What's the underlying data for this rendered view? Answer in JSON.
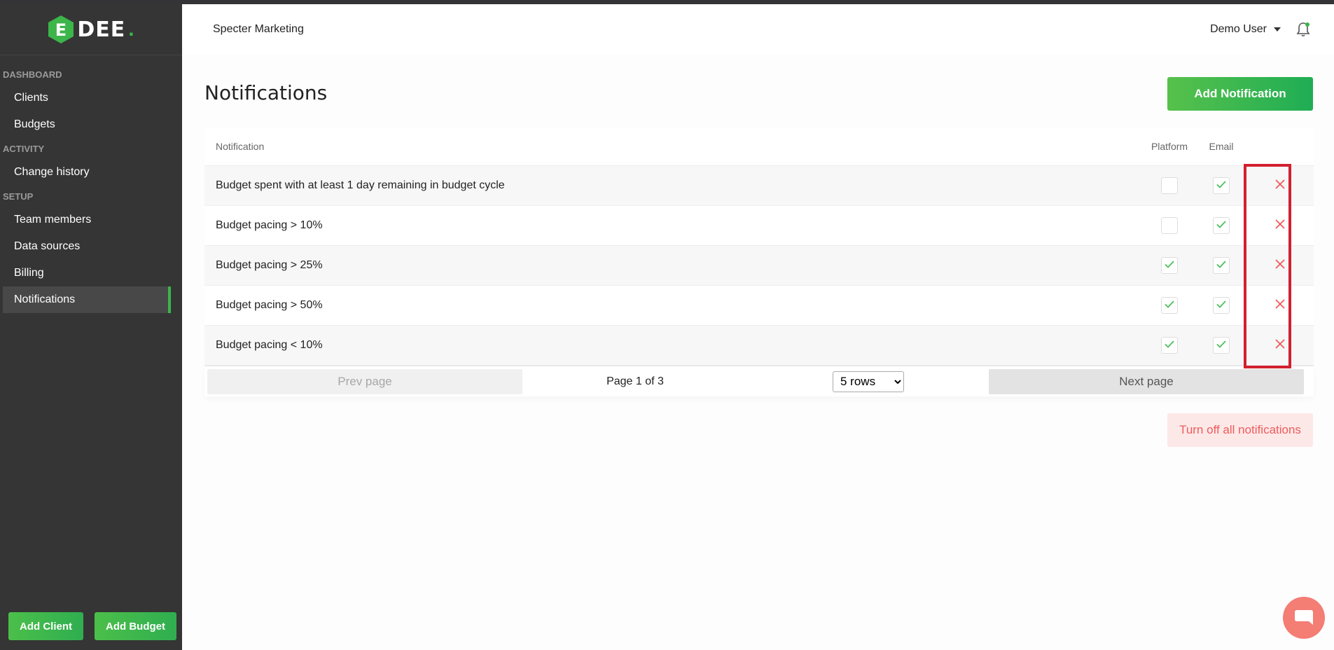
{
  "brand": {
    "logo_letter": "E",
    "logo_text": "DEE",
    "logo_dot": "."
  },
  "header": {
    "org_name": "Specter Marketing",
    "user_name": "Demo User"
  },
  "sidebar": {
    "sections": [
      {
        "title": "DASHBOARD",
        "items": [
          "Clients",
          "Budgets"
        ]
      },
      {
        "title": "ACTIVITY",
        "items": [
          "Change history"
        ]
      },
      {
        "title": "SETUP",
        "items": [
          "Team members",
          "Data sources",
          "Billing",
          "Notifications"
        ]
      }
    ],
    "active_item": "Notifications",
    "add_client_label": "Add Client",
    "add_budget_label": "Add Budget"
  },
  "main": {
    "title": "Notifications",
    "add_button_label": "Add Notification",
    "table": {
      "headers": {
        "notification": "Notification",
        "platform": "Platform",
        "email": "Email"
      },
      "rows": [
        {
          "name": "Budget spent with at least 1 day remaining in budget cycle",
          "platform": false,
          "email": true
        },
        {
          "name": "Budget pacing > 10%",
          "platform": false,
          "email": true
        },
        {
          "name": "Budget pacing > 25%",
          "platform": true,
          "email": true
        },
        {
          "name": "Budget pacing > 50%",
          "platform": true,
          "email": true
        },
        {
          "name": "Budget pacing < 10%",
          "platform": true,
          "email": true
        }
      ]
    },
    "pager": {
      "prev_label": "Prev page",
      "page_info": "Page 1 of 3",
      "rows_selected": "5 rows",
      "next_label": "Next page"
    },
    "turn_off_label": "Turn off all notifications"
  },
  "colors": {
    "sidebar_bg": "#353535",
    "accent_green": "#3cb54a",
    "delete_red": "#ef5b5b",
    "highlight_red": "#d2202f",
    "chat_bubble": "#f47d74"
  }
}
